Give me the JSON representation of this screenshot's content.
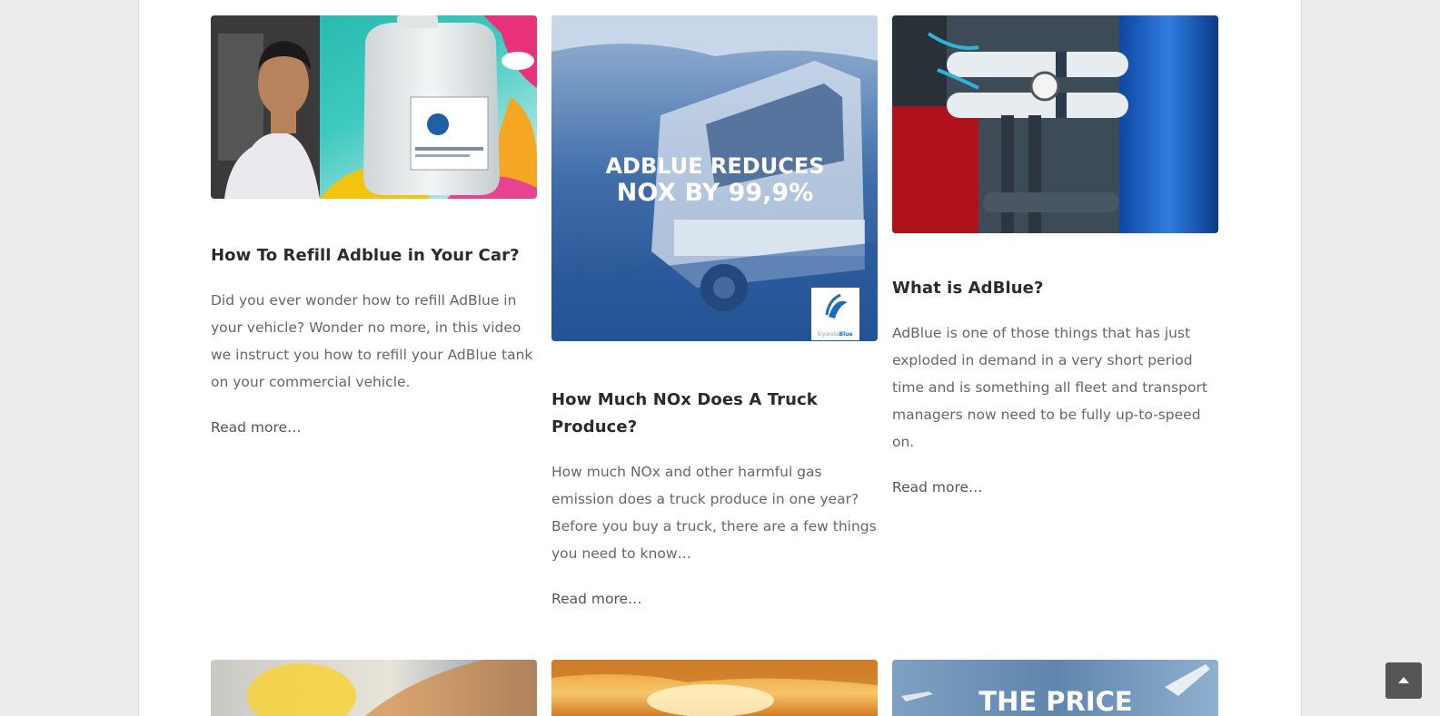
{
  "posts": [
    {
      "title": "How To Refill Adblue in Your Car?",
      "excerpt": "Did you ever wonder how to refill AdBlue in your vehicle? Wonder no more, in this video we instruct you how to refill your AdBlue tank on your commercial vehicle.",
      "read_more": "Read more…"
    },
    {
      "title": "How Much NOx Does A Truck Produce?",
      "excerpt": "How much NOx and other harmful gas emission does a truck produce in one year? Before you buy a truck, there are a few things you need to know…",
      "read_more": "Read more…",
      "image_text_line1": "ADBLUE REDUCES",
      "image_text_line2": "NOX BY 99,9%",
      "image_brand_prefix": "Siyanda",
      "image_brand_suffix": "Blue"
    },
    {
      "title": "What is AdBlue?",
      "excerpt": "AdBlue is one of those things that has just exploded in demand in a very short period time and is something all fleet and transport managers now need to be fully up-to-speed on.",
      "read_more": "Read more…"
    }
  ],
  "next_row": {
    "third_image_text": "THE PRICE"
  },
  "icons": {
    "scroll_top": "chevron-up-icon"
  },
  "colors": {
    "page_bg": "#ececec",
    "content_bg": "#ffffff",
    "title": "#2b2b2b",
    "text": "#666666",
    "scroll_button": "#555555"
  }
}
